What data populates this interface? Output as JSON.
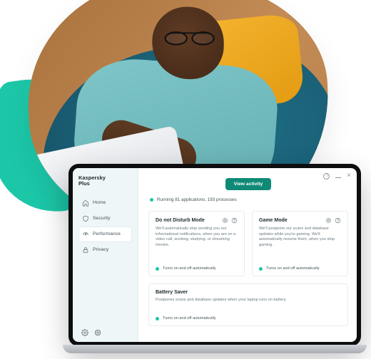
{
  "brand": {
    "line1": "Kaspersky",
    "line2": "Plus"
  },
  "sidebar": {
    "items": [
      {
        "id": "home",
        "label": "Home"
      },
      {
        "id": "security",
        "label": "Security"
      },
      {
        "id": "performance",
        "label": "Performance"
      },
      {
        "id": "privacy",
        "label": "Privacy"
      }
    ],
    "active_id": "performance"
  },
  "main": {
    "cta_label": "View activity",
    "status_text": "Running 81 applications, 193 processes"
  },
  "cards": {
    "dnd": {
      "title": "Do not Disturb Mode",
      "body": "We'll automatically stop sending you our informational notifications, when you are on a video call, working, studying, or streaming movies.",
      "footnote": "Turns on and off automatically"
    },
    "game": {
      "title": "Game Mode",
      "body": "We'll postpone our scans and database updates while you're gaming. We'll automatically resume them, when you stop gaming.",
      "footnote": "Turns on and off automatically"
    },
    "battery": {
      "title": "Battery Saver",
      "body": "Postpones scans and database updates when your laptop runs on battery.",
      "footnote": "Turns on and off automatically"
    }
  },
  "colors": {
    "accent": "#1cc7a8",
    "cta": "#0f8a77"
  }
}
